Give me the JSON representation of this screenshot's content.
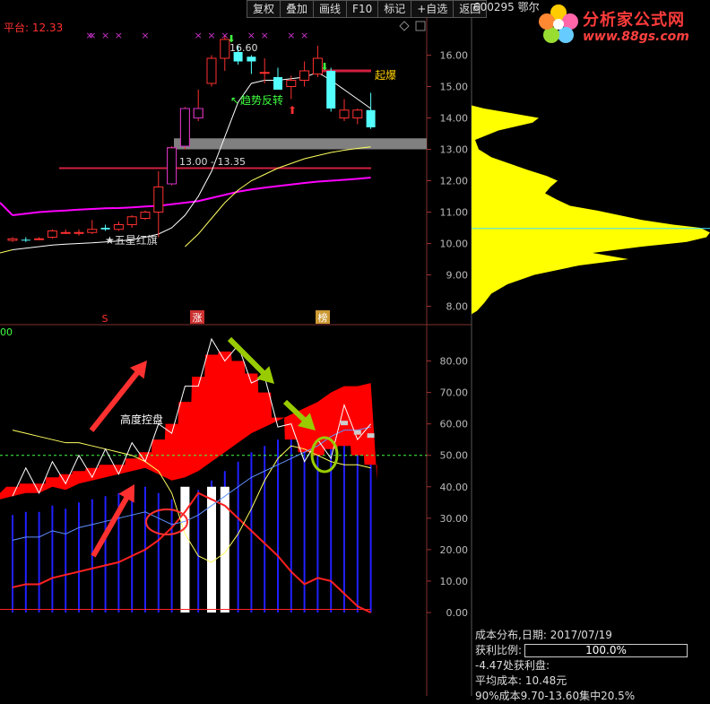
{
  "toolbar": {
    "buttons": [
      "复权",
      "叠加",
      "画线",
      "F10",
      "标记",
      "+自选",
      "返回"
    ]
  },
  "header": {
    "platform_label": "平台: 12.33",
    "stock_code": "600295 鄂尔",
    "sub_label": "00"
  },
  "logo": {
    "title": "分析家公式网",
    "url": "www.88gs.com"
  },
  "price_chart": {
    "y_ticks": [
      "16.00",
      "15.00",
      "14.00",
      "13.00",
      "12.00",
      "11.00",
      "10.00",
      "9.00",
      "8.00"
    ],
    "y_tick_values": [
      16,
      15,
      14,
      13,
      12,
      11,
      10,
      9,
      8
    ],
    "annotations": {
      "high_price": "16.60",
      "breakout": "起爆",
      "trend_reversal": "趋势反转",
      "five_star": "★五星红旗",
      "platform_range": "13.00 - 13.35",
      "marker_s": "S",
      "marker_zhang": "涨",
      "marker_bang": "榜"
    },
    "colors": {
      "up": "#ff3030",
      "down": "#54ffff",
      "ma_long": "#ff00ff",
      "ma_short": "#ffffff",
      "ma_mid": "#ffff60",
      "platform_band": "#808080",
      "resistance_line": "#d02040"
    }
  },
  "indicator_chart": {
    "y_ticks": [
      "80.00",
      "70.00",
      "60.00",
      "50.00",
      "40.00",
      "30.00",
      "20.00",
      "10.00",
      "0.00"
    ],
    "y_tick_values": [
      80,
      70,
      60,
      50,
      40,
      30,
      20,
      10,
      0
    ],
    "annotation": "高度控盘",
    "colors": {
      "fill": "#ff0000",
      "bars": "#2020ff",
      "white_bars": "#ffffff",
      "line_red": "#ff2020",
      "line_yellow": "#ffff60",
      "line_blue": "#6090ff",
      "dashed": "#40ff40",
      "arrow_red": "#ff3030",
      "arrow_green": "#99cc00"
    }
  },
  "chart_data": [
    {
      "type": "candlestick",
      "title": "",
      "ylim": [
        7.7,
        16.9
      ],
      "candles": [
        {
          "o": 10.1,
          "c": 10.15,
          "h": 10.2,
          "l": 10.05
        },
        {
          "o": 10.12,
          "c": 10.1,
          "h": 10.2,
          "l": 10.05
        },
        {
          "o": 10.15,
          "c": 10.15,
          "h": 10.2,
          "l": 10.1
        },
        {
          "o": 10.2,
          "c": 10.4,
          "h": 10.45,
          "l": 10.15
        },
        {
          "o": 10.35,
          "c": 10.35,
          "h": 10.45,
          "l": 10.3
        },
        {
          "o": 10.35,
          "c": 10.35,
          "h": 10.45,
          "l": 10.25
        },
        {
          "o": 10.35,
          "c": 10.45,
          "h": 10.75,
          "l": 10.3
        },
        {
          "o": 10.5,
          "c": 10.45,
          "h": 10.6,
          "l": 10.4
        },
        {
          "o": 10.45,
          "c": 10.6,
          "h": 10.7,
          "l": 10.4
        },
        {
          "o": 10.6,
          "c": 10.85,
          "h": 10.9,
          "l": 10.5
        },
        {
          "o": 10.8,
          "c": 11.0,
          "h": 11.05,
          "l": 10.75
        },
        {
          "o": 11.0,
          "c": 11.8,
          "h": 12.3,
          "l": 10.2
        },
        {
          "o": 11.9,
          "c": 13.05,
          "h": 13.1,
          "l": 11.85
        },
        {
          "o": 13.1,
          "c": 14.3,
          "h": 14.35,
          "l": 13.0
        },
        {
          "o": 14.0,
          "c": 14.3,
          "h": 14.9,
          "l": 13.9
        },
        {
          "o": 15.1,
          "c": 15.9,
          "h": 16.0,
          "l": 15.0
        },
        {
          "o": 15.9,
          "c": 16.5,
          "h": 16.6,
          "l": 15.5
        },
        {
          "o": 16.1,
          "c": 15.8,
          "h": 16.3,
          "l": 15.7
        },
        {
          "o": 15.95,
          "c": 15.8,
          "h": 16.0,
          "l": 15.4
        },
        {
          "o": 15.45,
          "c": 15.45,
          "h": 15.9,
          "l": 15.1
        },
        {
          "o": 15.3,
          "c": 14.9,
          "h": 15.6,
          "l": 14.9
        },
        {
          "o": 15.0,
          "c": 15.2,
          "h": 15.35,
          "l": 14.6
        },
        {
          "o": 15.2,
          "c": 15.5,
          "h": 15.8,
          "l": 15.0
        },
        {
          "o": 15.4,
          "c": 15.9,
          "h": 16.3,
          "l": 15.3
        },
        {
          "o": 15.5,
          "c": 14.3,
          "h": 15.6,
          "l": 14.2
        },
        {
          "o": 14.0,
          "c": 14.25,
          "h": 14.6,
          "l": 13.9
        },
        {
          "o": 14.0,
          "c": 14.25,
          "h": 14.3,
          "l": 13.8
        },
        {
          "o": 14.25,
          "c": 13.7,
          "h": 14.8,
          "l": 13.65
        }
      ],
      "ma_long": [
        10.9,
        10.95,
        11.0,
        11.03,
        11.05,
        11.08,
        11.1,
        11.12,
        11.13,
        11.15,
        11.18,
        11.2,
        11.25,
        11.3,
        11.35,
        11.45,
        11.55,
        11.65,
        11.72,
        11.78,
        11.83,
        11.88,
        11.93,
        11.97,
        12.0,
        12.03,
        12.06,
        12.1
      ],
      "ma_short": [
        9.8,
        9.85,
        9.9,
        9.95,
        9.98,
        10.0,
        10.02,
        10.05,
        10.08,
        10.12,
        10.2,
        10.3,
        10.5,
        10.9,
        11.5,
        12.3,
        13.4,
        14.5,
        15.1,
        15.2,
        15.2,
        15.25,
        15.3,
        15.45,
        15.2,
        14.9,
        14.6,
        14.3
      ],
      "ma_mid": [
        null,
        null,
        null,
        null,
        null,
        null,
        null,
        null,
        null,
        null,
        null,
        null,
        null,
        9.9,
        10.3,
        10.8,
        11.3,
        11.7,
        12.0,
        12.2,
        12.4,
        12.55,
        12.7,
        12.8,
        12.9,
        12.97,
        13.03,
        13.08
      ]
    },
    {
      "type": "area",
      "title": "",
      "ylim": [
        -2,
        87
      ],
      "series": [
        {
          "values": [
            40,
            41,
            41,
            43,
            44,
            45,
            46,
            47,
            47,
            49,
            51,
            55,
            60,
            67,
            75,
            82,
            83,
            80,
            76,
            70,
            62,
            55,
            51,
            50,
            52,
            53,
            50,
            47
          ]
        },
        {
          "values": [
            21,
            22,
            22,
            24,
            23,
            25,
            26,
            27,
            28,
            29,
            30,
            28,
            26,
            27,
            29,
            32,
            35,
            38,
            41,
            43,
            45,
            47,
            49,
            51,
            54,
            56,
            56,
            57
          ]
        }
      ],
      "line_red": [
        8,
        9,
        9,
        11,
        12,
        13,
        14,
        15,
        16,
        18,
        20,
        23,
        27,
        32,
        38,
        36,
        34,
        30,
        26,
        22,
        18,
        13,
        9,
        11,
        10,
        6,
        2,
        0
      ],
      "line_yellow": [
        58,
        57,
        56,
        55,
        54,
        54,
        53,
        52,
        51,
        50,
        48,
        45,
        38,
        25,
        18,
        16,
        19,
        25,
        33,
        42,
        49,
        53,
        52,
        50,
        48,
        47,
        47,
        46
      ]
    }
  ],
  "cost_panel": {
    "distribution_label": "成本分布,日期:",
    "date": "2017/07/19",
    "profit_ratio_label": "获利比例:",
    "profit_ratio_value": "100.0%",
    "profit_line": "-4.47处获利盘:",
    "avg_cost_label": "平均成本:",
    "avg_cost_value": "10.48元",
    "concentration": "90%成本9.70-13.60集中20.5%"
  }
}
